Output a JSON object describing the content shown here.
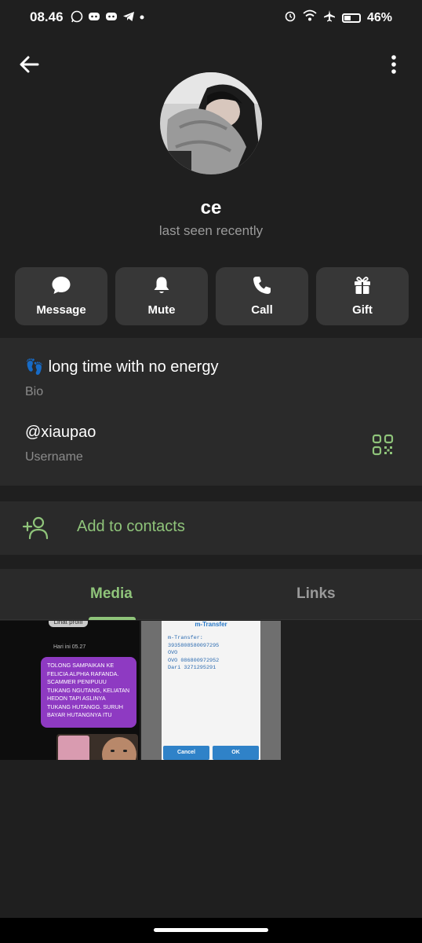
{
  "status_bar": {
    "time": "08.46",
    "battery": "46%",
    "battery_level": 0.46
  },
  "profile": {
    "name": "ce",
    "last_seen": "last seen recently"
  },
  "actions": [
    {
      "label": "Message",
      "icon": "chat-bubble-icon"
    },
    {
      "label": "Mute",
      "icon": "bell-icon"
    },
    {
      "label": "Call",
      "icon": "phone-icon"
    },
    {
      "label": "Gift",
      "icon": "gift-icon"
    }
  ],
  "info": {
    "bio_emoji": "👣",
    "bio": "long time with no energy",
    "bio_label": "Bio",
    "username": "@xiaupao",
    "username_label": "Username"
  },
  "contacts": {
    "add_label": "Add to contacts"
  },
  "tabs": {
    "media": "Media",
    "links": "Links"
  },
  "media": {
    "thumb1": {
      "chip": "Lihat profil",
      "time": "Hari ini 05.27",
      "bubble_text": "TOLONG SAMPAIKAN KE FELICIA ALPHIA RAFANDA. SCAMMER PENIPUUU TUKANG NGUTANG, KELIATAN HEDON TAPI ASLINYA TUKANG HUTANGG. SURUH BAYAR HUTANGNYA ITU"
    },
    "thumb2": {
      "title": "m-Transfer",
      "lines": [
        "m-Transfer:",
        "3935808580097295",
        "OVO",
        "OVO 086800972952",
        "Dari 3271295291"
      ],
      "cancel": "Cancel",
      "ok": "OK"
    }
  },
  "colors": {
    "accent": "#8fc47a",
    "background": "#1f1f1f",
    "card": "#2a2a2a",
    "button": "#373737"
  }
}
